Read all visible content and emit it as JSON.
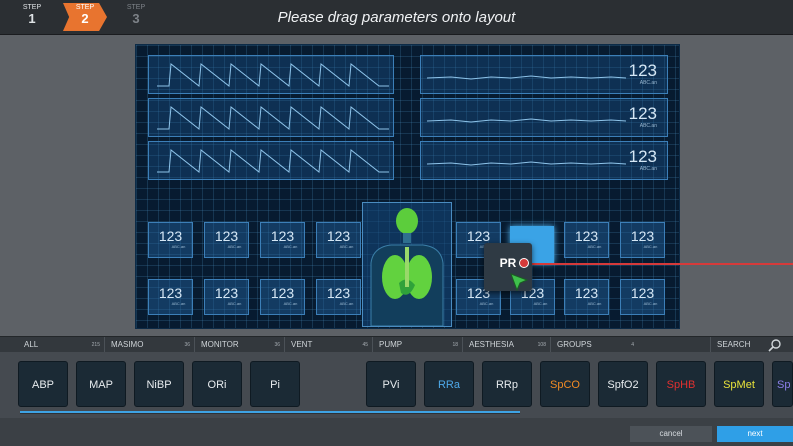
{
  "wizard": {
    "steps": [
      {
        "label": "STEP",
        "number": "1"
      },
      {
        "label": "STEP",
        "number": "2"
      },
      {
        "label": "STEP",
        "number": "3"
      }
    ],
    "title": "Please drag parameters onto layout"
  },
  "layout_preview": {
    "wave_rows": [
      {
        "value": "123",
        "sub": "ABC.an"
      },
      {
        "value": "123",
        "sub": "ABC.an"
      },
      {
        "value": "123",
        "sub": "ABC.an"
      }
    ],
    "tile_value": "123",
    "tile_sub": "ABC.an",
    "drag_chip_label": "PR"
  },
  "filters": [
    {
      "label": "ALL",
      "count": "215"
    },
    {
      "label": "MASIMO",
      "count": "36"
    },
    {
      "label": "MONITOR",
      "count": "36"
    },
    {
      "label": "VENT",
      "count": "45"
    },
    {
      "label": "PUMP",
      "count": "18"
    },
    {
      "label": "AESTHESIA",
      "count": "108"
    },
    {
      "label": "GROUPS",
      "count": "4"
    }
  ],
  "search_placeholder": "SEARCH",
  "parameters": [
    {
      "label": "ABP",
      "color": "#e8ecef"
    },
    {
      "label": "MAP",
      "color": "#e8ecef"
    },
    {
      "label": "NiBP",
      "color": "#e8ecef"
    },
    {
      "label": "ORi",
      "color": "#e8ecef"
    },
    {
      "label": "Pi",
      "color": "#e8ecef"
    },
    {
      "label": "PVi",
      "color": "#e8ecef"
    },
    {
      "label": "RRa",
      "color": "#4ea8e8"
    },
    {
      "label": "RRp",
      "color": "#e8ecef"
    },
    {
      "label": "SpCO",
      "color": "#f08a24"
    },
    {
      "label": "SpfO2",
      "color": "#e8ecef"
    },
    {
      "label": "SpHB",
      "color": "#e03030"
    },
    {
      "label": "SpMet",
      "color": "#e8e23a"
    },
    {
      "label": "Sp",
      "color": "#8a7ee8"
    }
  ],
  "actions": {
    "cancel": "cancel",
    "next": "next"
  },
  "colors": {
    "accent": "#2f9fe7",
    "step_active": "#e8742f",
    "drag_line": "#d63a3a"
  }
}
